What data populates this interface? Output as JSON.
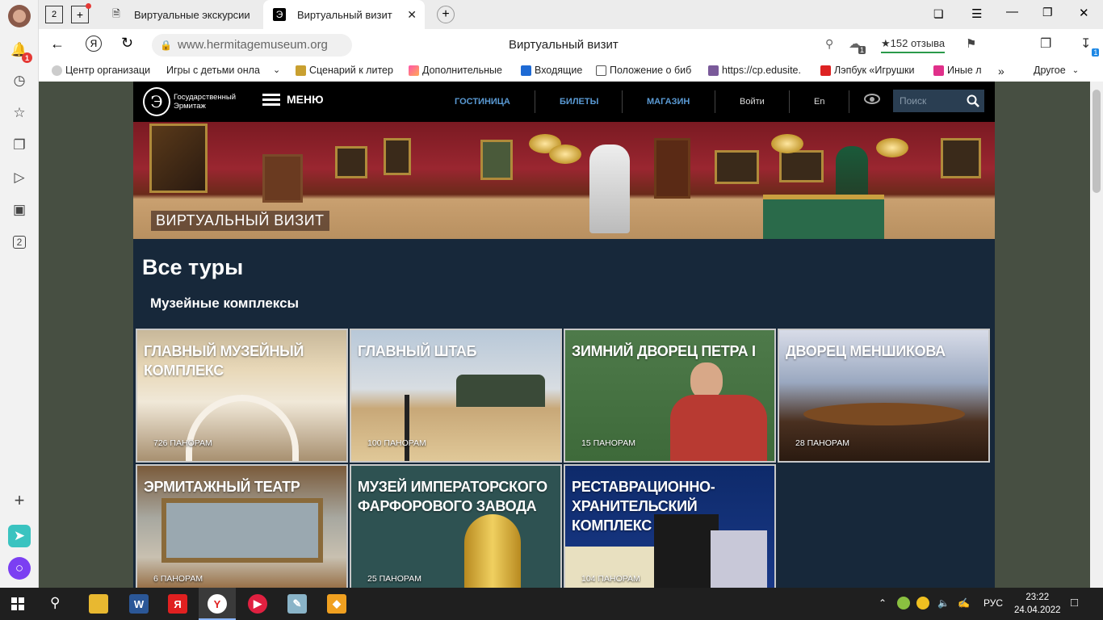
{
  "browser": {
    "tab_counter": "2",
    "tabs": [
      {
        "title": "Виртуальные экскурсии",
        "active": false
      },
      {
        "title": "Виртуальный визит",
        "active": true
      }
    ],
    "url": "www.hermitagemuseum.org",
    "page_title": "Виртуальный визит",
    "reviews": "★152 отзыва",
    "download_badge": "1",
    "collections_badge": "1",
    "bookmarks": [
      "Центр организаци",
      "Игры с детьми онла",
      "Сценарий к литер",
      "Дополнительные",
      "Входящие",
      "Положение о биб",
      "https://cp.edusite.",
      "Лэпбук «Игрушки",
      "Иные л"
    ],
    "bookmarks_more": "»",
    "bookmarks_other": "Другое"
  },
  "sidebar": {
    "notification_badge": "1",
    "tabs_counter": "2"
  },
  "site": {
    "logo_text": "Государственный Эрмитаж",
    "logo_letter": "Э",
    "menu_label": "МЕНЮ",
    "nav": [
      "ГОСТИНИЦА",
      "БИЛЕТЫ",
      "МАГАЗИН",
      "Войти",
      "En"
    ],
    "search_placeholder": "Поиск",
    "hero_label": "ВИРТУАЛЬНЫЙ ВИЗИТ",
    "heading": "Все туры",
    "subheading": "Музейные комплексы",
    "cards": [
      {
        "title": "ГЛАВНЫЙ МУЗЕЙНЫЙ КОМПЛЕКС",
        "count": "726 ПАНОРАМ"
      },
      {
        "title": "ГЛАВНЫЙ ШТАБ",
        "count": "100 ПАНОРАМ"
      },
      {
        "title": "ЗИМНИЙ ДВОРЕЦ ПЕТРА I",
        "count": "15 ПАНОРАМ"
      },
      {
        "title": "ДВОРЕЦ МЕНШИКОВА",
        "count": "28 ПАНОРАМ"
      },
      {
        "title": "ЭРМИТАЖНЫЙ ТЕАТР",
        "count": "6 ПАНОРАМ"
      },
      {
        "title": "МУЗЕЙ ИМПЕРАТОРСКОГО ФАРФОРОВОГО ЗАВОДА",
        "count": "25 ПАНОРАМ"
      },
      {
        "title": "РЕСТАВРАЦИОННО-ХРАНИТЕЛЬСКИЙ КОМПЛЕКС",
        "count": "104 ПАНОРАМ"
      }
    ]
  },
  "taskbar": {
    "lang": "РУС",
    "time": "23:22",
    "date": "24.04.2022"
  }
}
